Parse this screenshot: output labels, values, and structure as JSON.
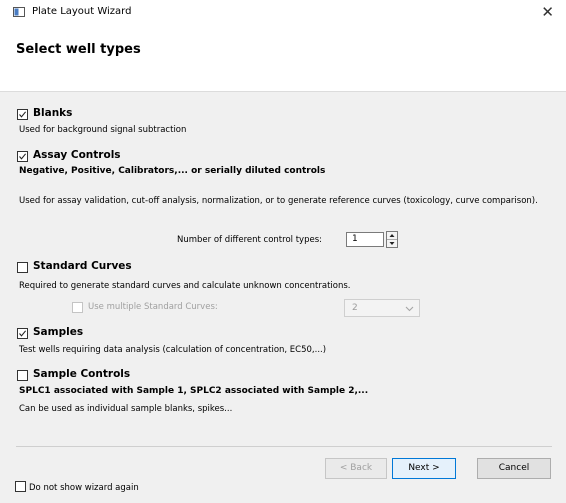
{
  "window": {
    "title": "Plate Layout Wizard",
    "close_icon": "close-icon"
  },
  "header": {
    "title": "Select well types"
  },
  "sections": {
    "blanks": {
      "checked": true,
      "label": "Blanks",
      "description": "Used for background signal subtraction"
    },
    "assay_controls": {
      "checked": true,
      "label": "Assay Controls",
      "subtitle": "Negative, Positive, Calibrators,... or serially diluted controls",
      "description": "Used for assay validation, cut-off analysis, normalization, or to generate reference curves (toxicology, curve comparison).",
      "control_types_label": "Number of different control types:",
      "control_types_value": "1"
    },
    "standard_curves": {
      "checked": false,
      "label": "Standard Curves",
      "description": "Required to generate standard curves and calculate unknown concentrations.",
      "multiple_label": "Use multiple Standard Curves:",
      "multiple_checked": false,
      "multiple_value": "2"
    },
    "samples": {
      "checked": true,
      "label": "Samples",
      "description": "Test wells requiring data analysis (calculation of concentration, EC50,...)"
    },
    "sample_controls": {
      "checked": false,
      "label": "Sample Controls",
      "subtitle": "SPLC1 associated with Sample 1, SPLC2 associated with Sample 2,...",
      "description": "Can be used as individual sample blanks, spikes..."
    }
  },
  "footer": {
    "back_label": "< Back",
    "next_label": "Next >",
    "cancel_label": "Cancel",
    "dont_show_label": "Do not show wizard again",
    "dont_show_checked": false
  },
  "colors": {
    "accent": "#0078d7",
    "background": "#f0f0f0",
    "header_bg": "#ffffff"
  }
}
